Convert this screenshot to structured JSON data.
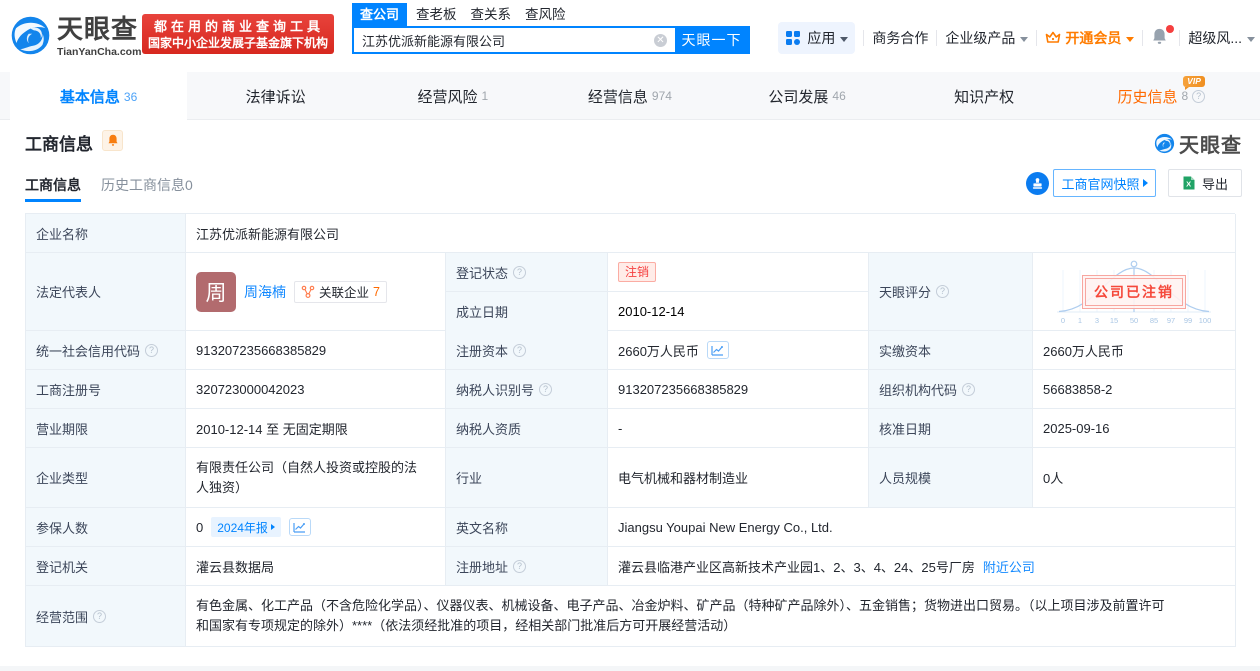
{
  "brand": {
    "name": "天眼查",
    "domain": "TianYanCha.com",
    "promo_line1": "都在用的商业查询工具",
    "promo_line2": "国家中小企业发展子基金旗下机构",
    "corner_logo_text": "天眼查"
  },
  "search": {
    "tabs": [
      {
        "label": "查公司"
      },
      {
        "label": "查老板"
      },
      {
        "label": "查关系"
      },
      {
        "label": "查风险"
      }
    ],
    "value": "江苏优派新能源有限公司",
    "button": "天眼一下"
  },
  "nav": {
    "apps": "应用",
    "cooperation": "商务合作",
    "enterprise": "企业级产品",
    "vip": "开通会员",
    "super_risk": "超级风..."
  },
  "main_tabs": [
    {
      "label": "基本信息",
      "count": "36"
    },
    {
      "label": "法律诉讼",
      "count": ""
    },
    {
      "label": "经营风险",
      "count": "1"
    },
    {
      "label": "经营信息",
      "count": "974"
    },
    {
      "label": "公司发展",
      "count": "46"
    },
    {
      "label": "知识产权",
      "count": ""
    },
    {
      "label": "历史信息",
      "count": "8",
      "vip_badge": "VIP"
    }
  ],
  "section": {
    "title": "工商信息",
    "subtab_active": "工商信息",
    "subtab_history": "历史工商信息0",
    "snapshot_button": "工商官网快照",
    "export_button": "导出"
  },
  "table": {
    "company_name_label": "企业名称",
    "company_name": "江苏优派新能源有限公司",
    "legal_rep_label": "法定代表人",
    "legal_rep_avatar": "周",
    "legal_rep_name": "周海楠",
    "related_companies_label": "关联企业",
    "related_companies_count": "7",
    "reg_status_label": "登记状态",
    "reg_status": "注销",
    "establish_date_label": "成立日期",
    "establish_date": "2010-12-14",
    "score_label": "天眼评分",
    "credit_code_label": "统一社会信用代码",
    "credit_code": "913207235668385829",
    "reg_capital_label": "注册资本",
    "reg_capital": "2660万人民币",
    "paid_capital_label": "实缴资本",
    "paid_capital": "2660万人民币",
    "reg_number_label": "工商注册号",
    "reg_number": "320723000042023",
    "taxpayer_id_label": "纳税人识别号",
    "taxpayer_id": "913207235668385829",
    "org_code_label": "组织机构代码",
    "org_code": "56683858-2",
    "business_term_label": "营业期限",
    "business_term": "2010-12-14 至 无固定期限",
    "taxpayer_quality_label": "纳税人资质",
    "taxpayer_quality": "-",
    "approval_date_label": "核准日期",
    "approval_date": "2025-09-16",
    "company_type_label": "企业类型",
    "company_type": "有限责任公司（自然人投资或控股的法人独资）",
    "industry_label": "行业",
    "industry": "电气机械和器材制造业",
    "staff_size_label": "人员规模",
    "staff_size": "0人",
    "insured_label": "参保人数",
    "insured_count": "0",
    "annual_report_badge": "2024年报",
    "english_name_label": "英文名称",
    "english_name": "Jiangsu Youpai New Energy Co., Ltd.",
    "reg_authority_label": "登记机关",
    "reg_authority": "灌云县数据局",
    "address_label": "注册地址",
    "address": "灌云县临港产业区高新技术产业园1、2、3、4、24、25号厂房",
    "nearby_link": "附近公司",
    "business_scope_label": "经营范围",
    "business_scope": "有色金属、化工产品（不含危险化学品）、仪器仪表、机械设备、电子产品、冶金炉料、矿产品（特种矿产品除外）、五金销售；货物进出口贸易。（以上项目涉及前置许可和国家有专项规定的除外）****（依法须经批准的项目，经相关部门批准后方可开展经营活动）"
  },
  "score_chart": {
    "ticks": [
      "0",
      "1",
      "3",
      "15",
      "50",
      "85",
      "97",
      "99",
      "100"
    ],
    "stamp": "公司已注销"
  },
  "colors": {
    "brand_blue": "#0084ff",
    "promo_red": "#dd2f26",
    "vip_orange": "#ff7c00",
    "status_red": "#f53f3f"
  }
}
